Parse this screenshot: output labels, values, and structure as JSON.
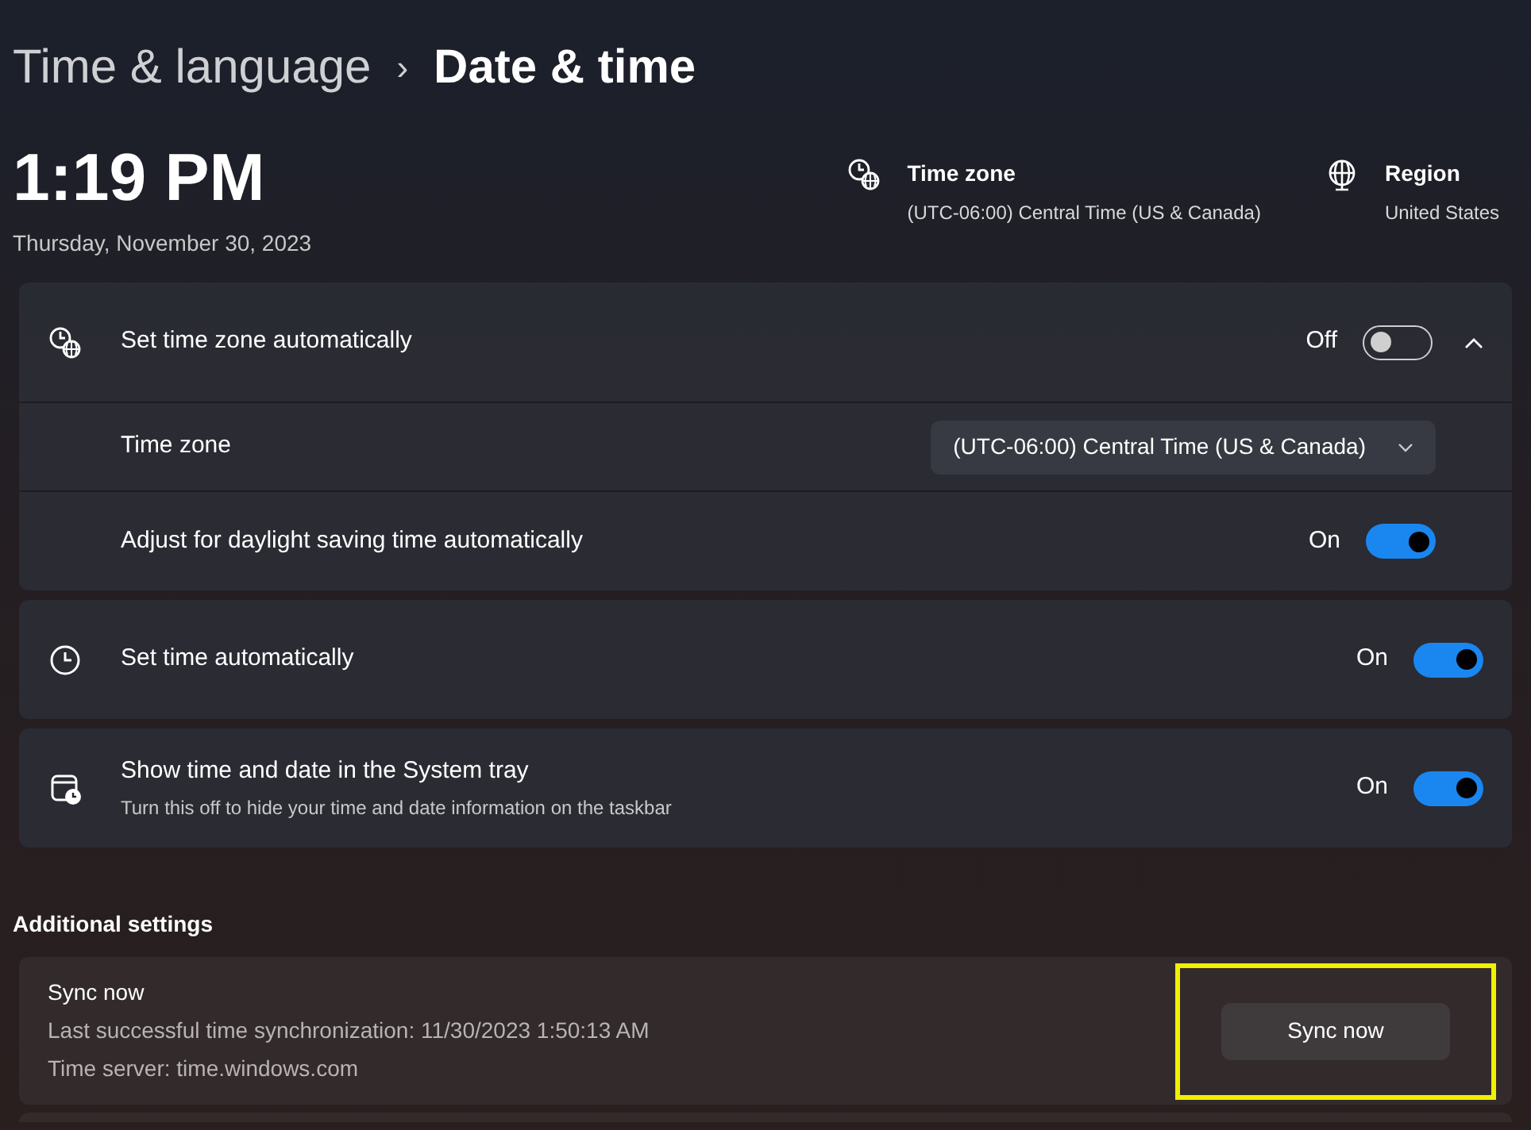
{
  "breadcrumb": {
    "parent": "Time & language",
    "separator": "›",
    "current": "Date & time"
  },
  "clock": {
    "time": "1:19 PM",
    "date": "Thursday, November 30, 2023"
  },
  "info": [
    {
      "kind": "timezone",
      "title": "Time zone",
      "value": "(UTC-06:00) Central Time (US & Canada)"
    },
    {
      "kind": "region",
      "title": "Region",
      "value": "United States"
    }
  ],
  "settings": [
    {
      "kind": "timezone",
      "label": "Set time zone automatically",
      "state_text": "Off",
      "on": false,
      "expanded": true,
      "children": [
        {
          "kind": "dropdown",
          "label": "Time zone",
          "value": "(UTC-06:00) Central Time (US & Canada)"
        },
        {
          "kind": "toggle",
          "label": "Adjust for daylight saving time automatically",
          "state_text": "On",
          "on": true
        }
      ]
    },
    {
      "kind": "clock",
      "label": "Set time automatically",
      "state_text": "On",
      "on": true
    },
    {
      "kind": "calendar",
      "label": "Show time and date in the System tray",
      "description": "Turn this off to hide your time and date information on the taskbar",
      "state_text": "On",
      "on": true
    }
  ],
  "additional": {
    "heading": "Additional settings",
    "sync": {
      "title": "Sync now",
      "lines": [
        "Last successful time synchronization: 11/30/2023 1:50:13 AM",
        "Time server: time.windows.com"
      ],
      "button": {
        "label": "Sync now",
        "highlighted": true
      }
    }
  }
}
